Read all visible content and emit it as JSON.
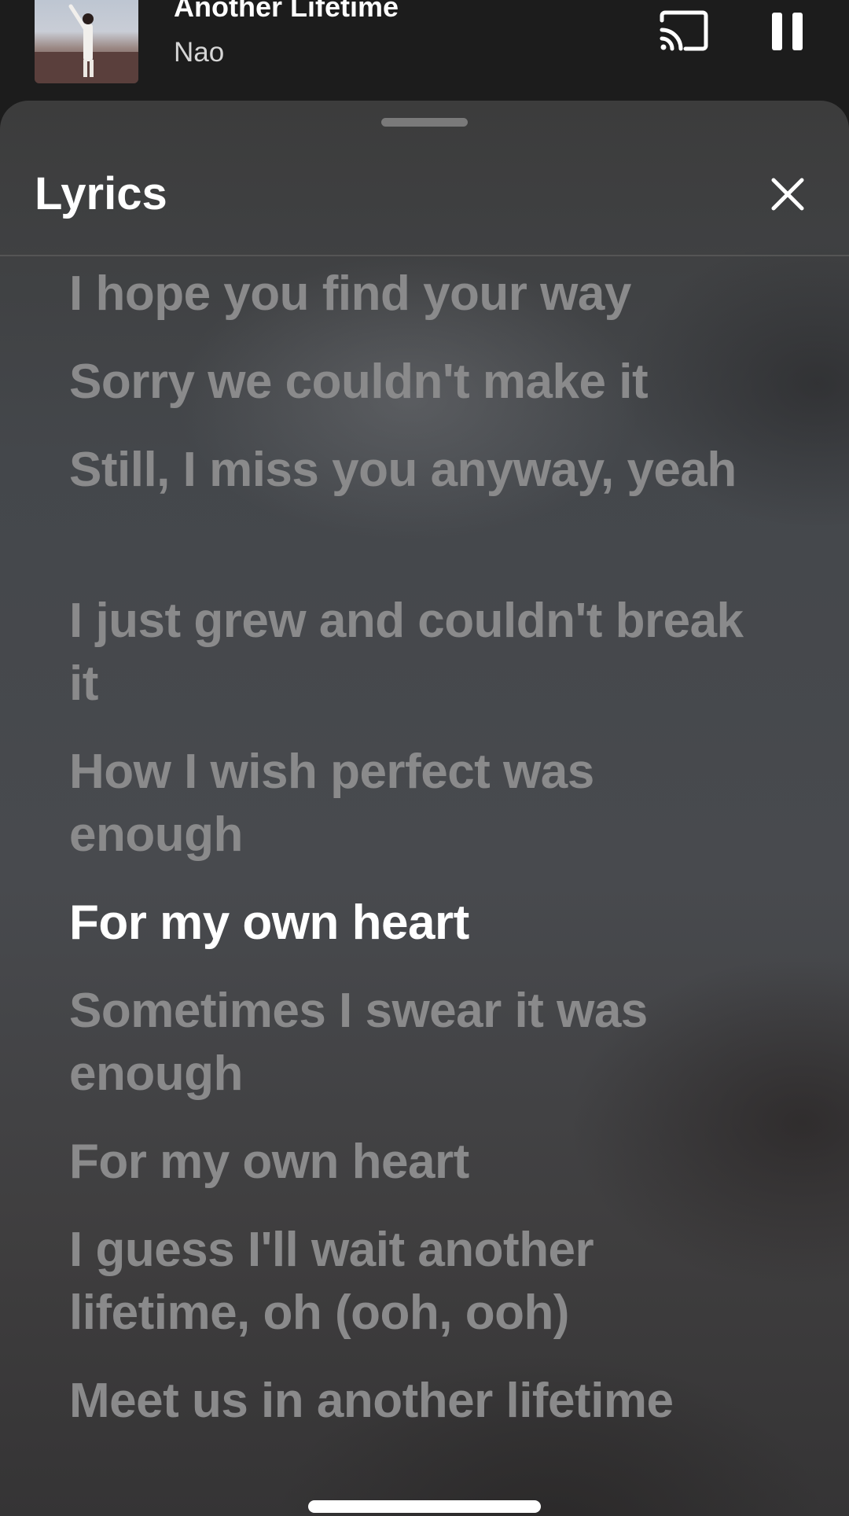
{
  "mini_player": {
    "album_art": "album-cover",
    "title": "Another Lifetime",
    "artist": "Nao",
    "cast_icon": "cast-icon",
    "pause_icon": "pause-icon"
  },
  "sheet": {
    "title": "Lyrics",
    "close_icon": "close-icon",
    "lyrics": [
      {
        "text": "I hope you find your way",
        "active": false
      },
      {
        "text": "Sorry we couldn't make it",
        "active": false
      },
      {
        "text": "Still, I miss you anyway, yeah",
        "active": false
      },
      {
        "text": "I just grew and couldn't break it",
        "active": false
      },
      {
        "text": "How I wish perfect was enough",
        "active": false
      },
      {
        "text": "For my own heart",
        "active": true
      },
      {
        "text": "Sometimes I swear it was enough",
        "active": false
      },
      {
        "text": "For my own heart",
        "active": false
      },
      {
        "text": "I guess I'll wait another lifetime, oh (ooh, ooh)",
        "active": false
      },
      {
        "text": "Meet us in another lifetime",
        "active": false
      }
    ]
  },
  "colors": {
    "active_lyric": "#ffffff",
    "inactive_lyric": "#8a8a8b",
    "top_bar": "#1c1c1c"
  }
}
